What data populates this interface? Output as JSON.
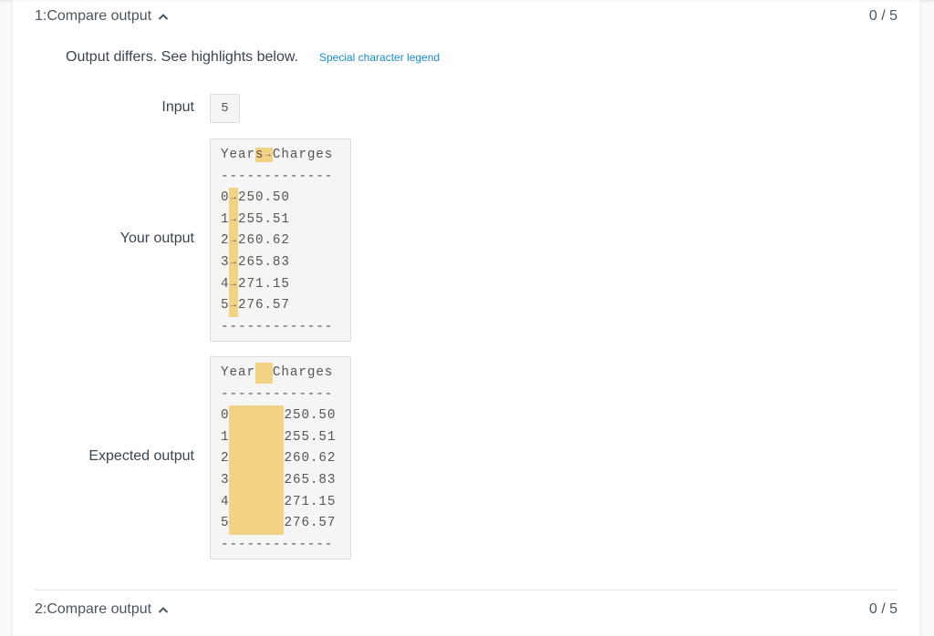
{
  "sections": [
    {
      "title": "1:Compare output",
      "score": "0 / 5",
      "status": "Output differs. See highlights below.",
      "legend_link": "Special character legend",
      "input_label": "Input",
      "input_value": "5",
      "your_output_label": "Your output",
      "expected_output_label": "Expected output",
      "your_output": {
        "header_a": "Year",
        "header_hl": "s",
        "header_tab": "→",
        "header_b": "Charges",
        "separator": "-------------",
        "rows": [
          {
            "year": "0",
            "tab": "→",
            "value": "250.50"
          },
          {
            "year": "1",
            "tab": "→",
            "value": "255.51"
          },
          {
            "year": "2",
            "tab": "→",
            "value": "260.62"
          },
          {
            "year": "3",
            "tab": "→",
            "value": "265.83"
          },
          {
            "year": "4",
            "tab": "→",
            "value": "271.15"
          },
          {
            "year": "5",
            "tab": "→",
            "value": "276.57"
          }
        ],
        "footer": "-------------"
      },
      "expected_output": {
        "header_a": "Year",
        "header_b": "Charges",
        "separator": "-------------",
        "rows": [
          {
            "year": "0",
            "value": "250.50"
          },
          {
            "year": "1",
            "value": "255.51"
          },
          {
            "year": "2",
            "value": "260.62"
          },
          {
            "year": "3",
            "value": "265.83"
          },
          {
            "year": "4",
            "value": "271.15"
          },
          {
            "year": "5",
            "value": "276.57"
          }
        ],
        "footer": "-------------"
      }
    },
    {
      "title": "2:Compare output",
      "score": "0 / 5"
    }
  ],
  "colors": {
    "highlight": "#f2d285",
    "link": "#1a8bc8"
  },
  "icons": {
    "collapse": "chevron-up-icon",
    "tab_marker": "tab-arrow-icon"
  }
}
